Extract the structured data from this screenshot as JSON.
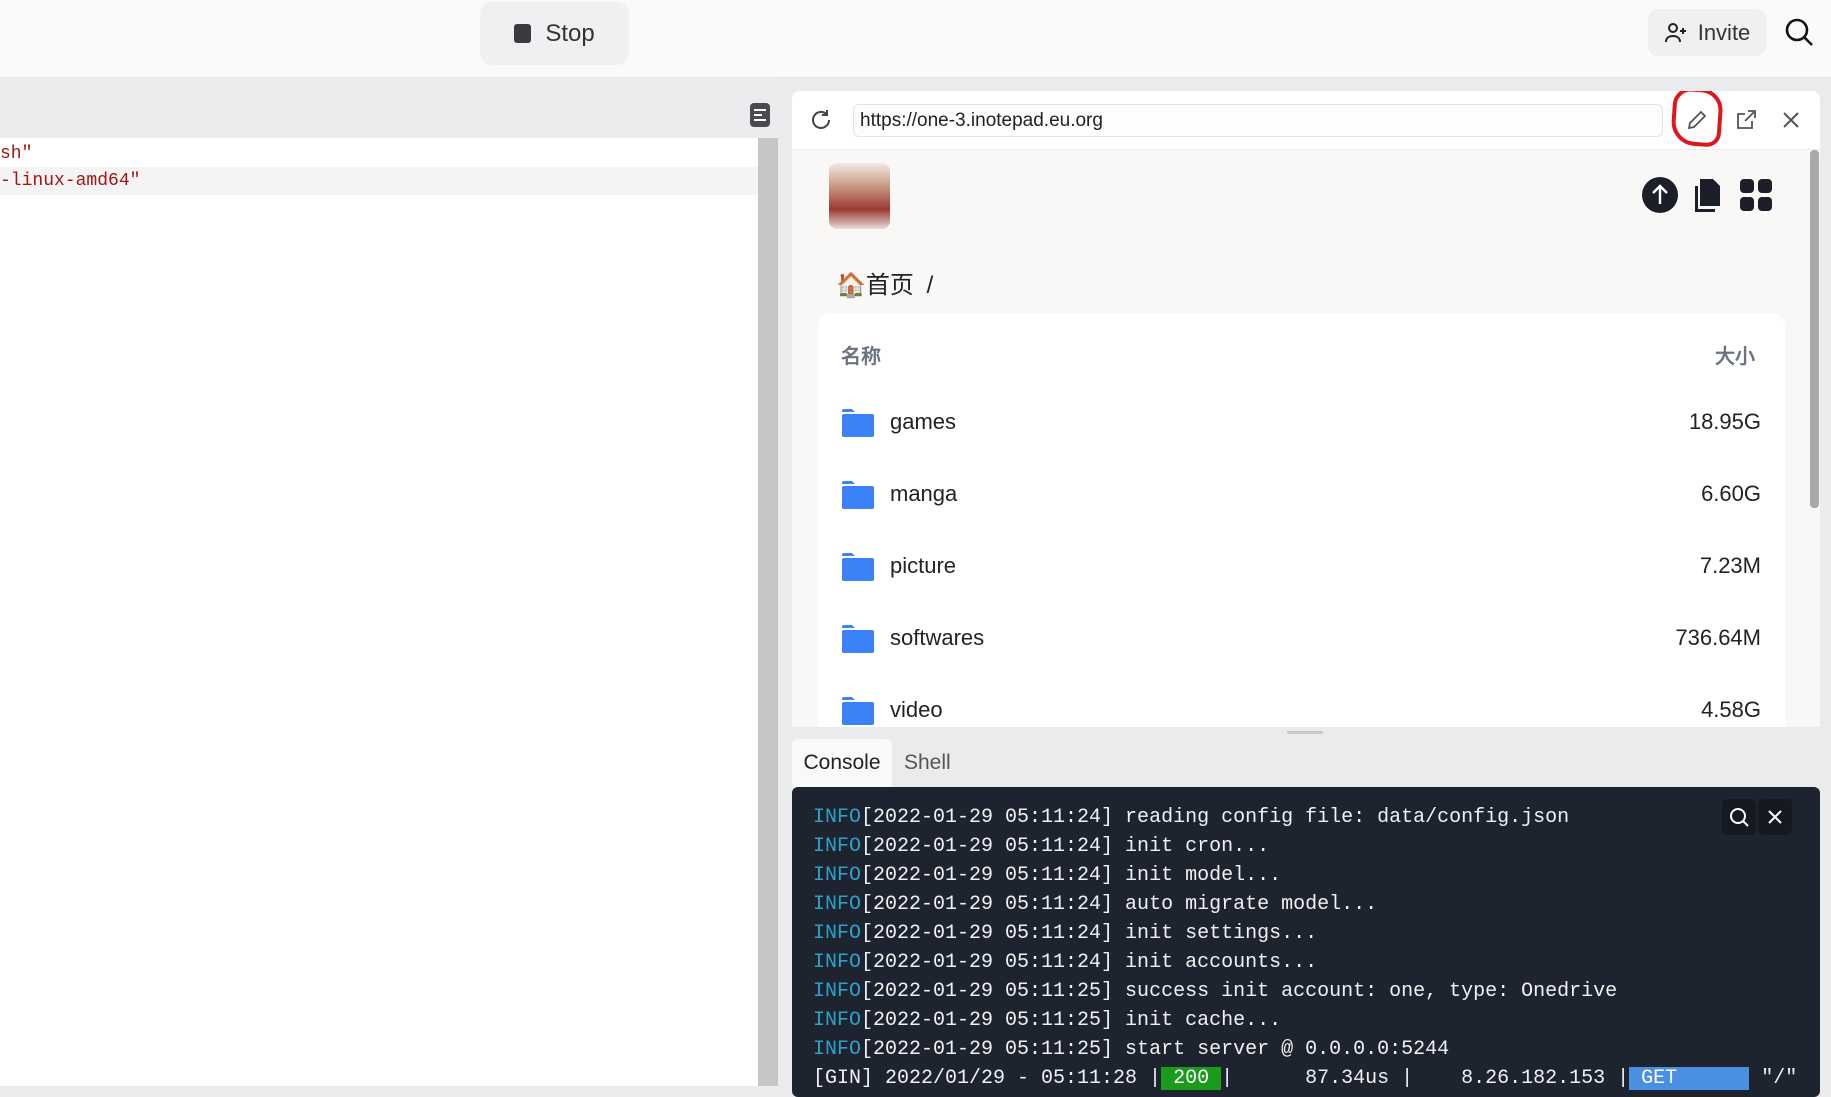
{
  "topbar": {
    "stop_label": "Stop",
    "invite_label": "Invite"
  },
  "editor": {
    "lines": [
      "sh\"",
      "-linux-amd64\""
    ]
  },
  "browser": {
    "url": "https://one-3.inotepad.eu.org",
    "breadcrumb": {
      "home": "首页",
      "separator": "/"
    },
    "table": {
      "headers": {
        "name": "名称",
        "size": "大小"
      },
      "rows": [
        {
          "name": "games",
          "size": "18.95G"
        },
        {
          "name": "manga",
          "size": "6.60G"
        },
        {
          "name": "picture",
          "size": "7.23M"
        },
        {
          "name": "softwares",
          "size": "736.64M"
        },
        {
          "name": "video",
          "size": "4.58G"
        }
      ]
    },
    "folder_color": "#3b82f6"
  },
  "tabs": {
    "console": "Console",
    "shell": "Shell"
  },
  "console": {
    "lines": [
      {
        "level": "INFO",
        "text": "[2022-01-29 05:11:24] reading config file: data/config.json"
      },
      {
        "level": "INFO",
        "text": "[2022-01-29 05:11:24] init cron..."
      },
      {
        "level": "INFO",
        "text": "[2022-01-29 05:11:24] init model..."
      },
      {
        "level": "INFO",
        "text": "[2022-01-29 05:11:24] auto migrate model..."
      },
      {
        "level": "INFO",
        "text": "[2022-01-29 05:11:24] init settings..."
      },
      {
        "level": "INFO",
        "text": "[2022-01-29 05:11:24] init accounts..."
      },
      {
        "level": "INFO",
        "text": "[2022-01-29 05:11:25] success init account: one, type: Onedrive"
      },
      {
        "level": "INFO",
        "text": "[2022-01-29 05:11:25] init cache..."
      },
      {
        "level": "INFO",
        "text": "[2022-01-29 05:11:25] start server @ 0.0.0.0:5244"
      }
    ],
    "gin": {
      "prefix": "[GIN] 2022/01/29 - 05:11:28 |",
      "status": " 200 ",
      "mid": "|      87.34us |    8.26.182.153 |",
      "method": " GET      ",
      "path": " \"/\""
    }
  }
}
